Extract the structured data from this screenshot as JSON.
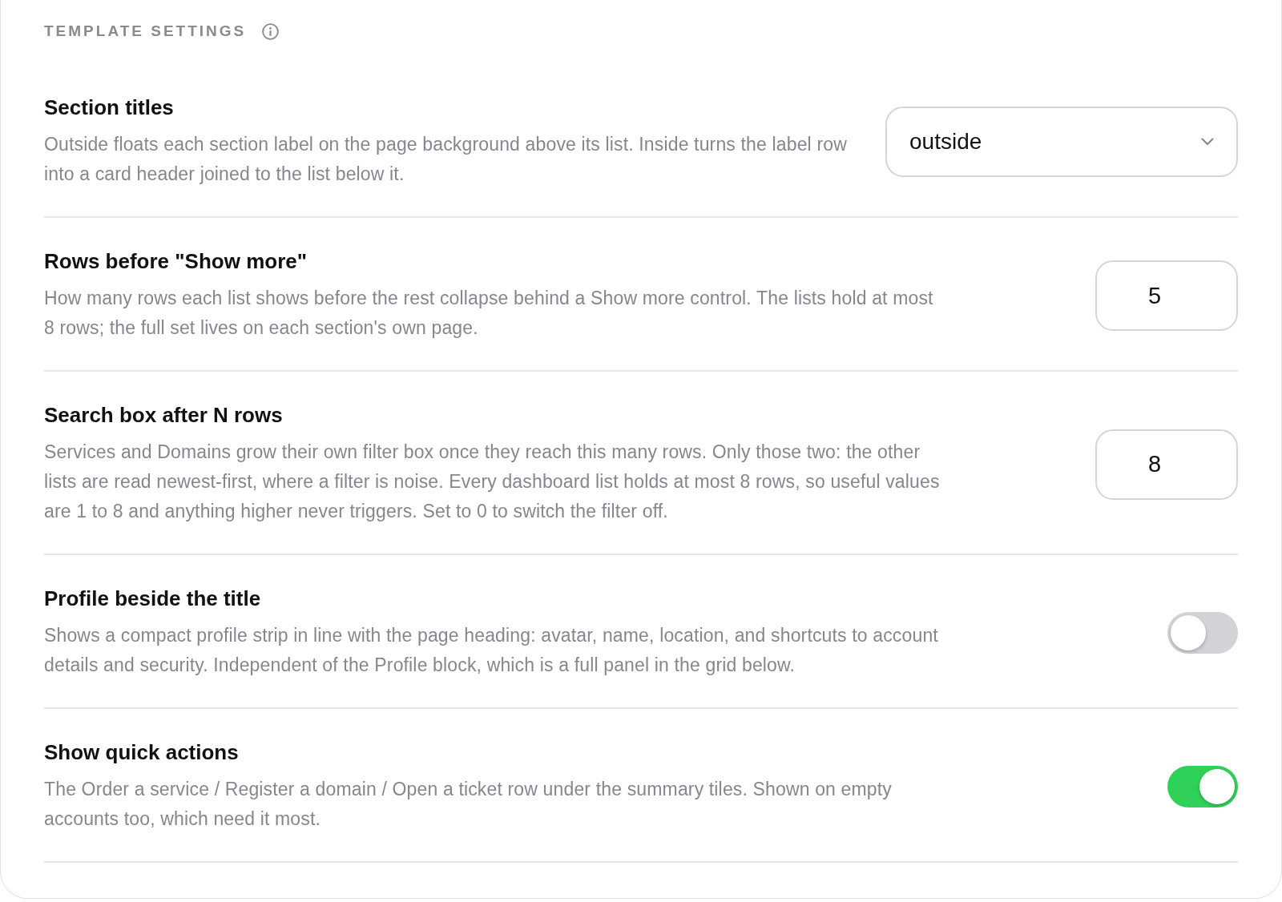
{
  "header": {
    "title": "TEMPLATE SETTINGS"
  },
  "settings": [
    {
      "kind": "select",
      "title": "Section titles",
      "description": "Outside floats each section label on the page background above its list. Inside turns the label row into a card header joined to the list below it.",
      "value": "outside"
    },
    {
      "kind": "number",
      "title": "Rows before \"Show more\"",
      "description": "How many rows each list shows before the rest collapse behind a Show more control. The lists hold at most 8 rows; the full set lives on each section's own page.",
      "value": "5"
    },
    {
      "kind": "number",
      "title": "Search box after N rows",
      "description": "Services and Domains grow their own filter box once they reach this many rows. Only those two: the other lists are read newest-first, where a filter is noise. Every dashboard list holds at most 8 rows, so useful values are 1 to 8 and anything higher never triggers. Set to 0 to switch the filter off.",
      "value": "8"
    },
    {
      "kind": "toggle",
      "title": "Profile beside the title",
      "description": "Shows a compact profile strip in line with the page heading: avatar, name, location, and shortcuts to account details and security. Independent of the Profile block, which is a full panel in the grid below.",
      "on": false
    },
    {
      "kind": "toggle",
      "title": "Show quick actions",
      "description": "The Order a service / Register a domain / Open a ticket row under the summary tiles. Shown on empty accounts too, which need it most.",
      "on": true
    }
  ]
}
